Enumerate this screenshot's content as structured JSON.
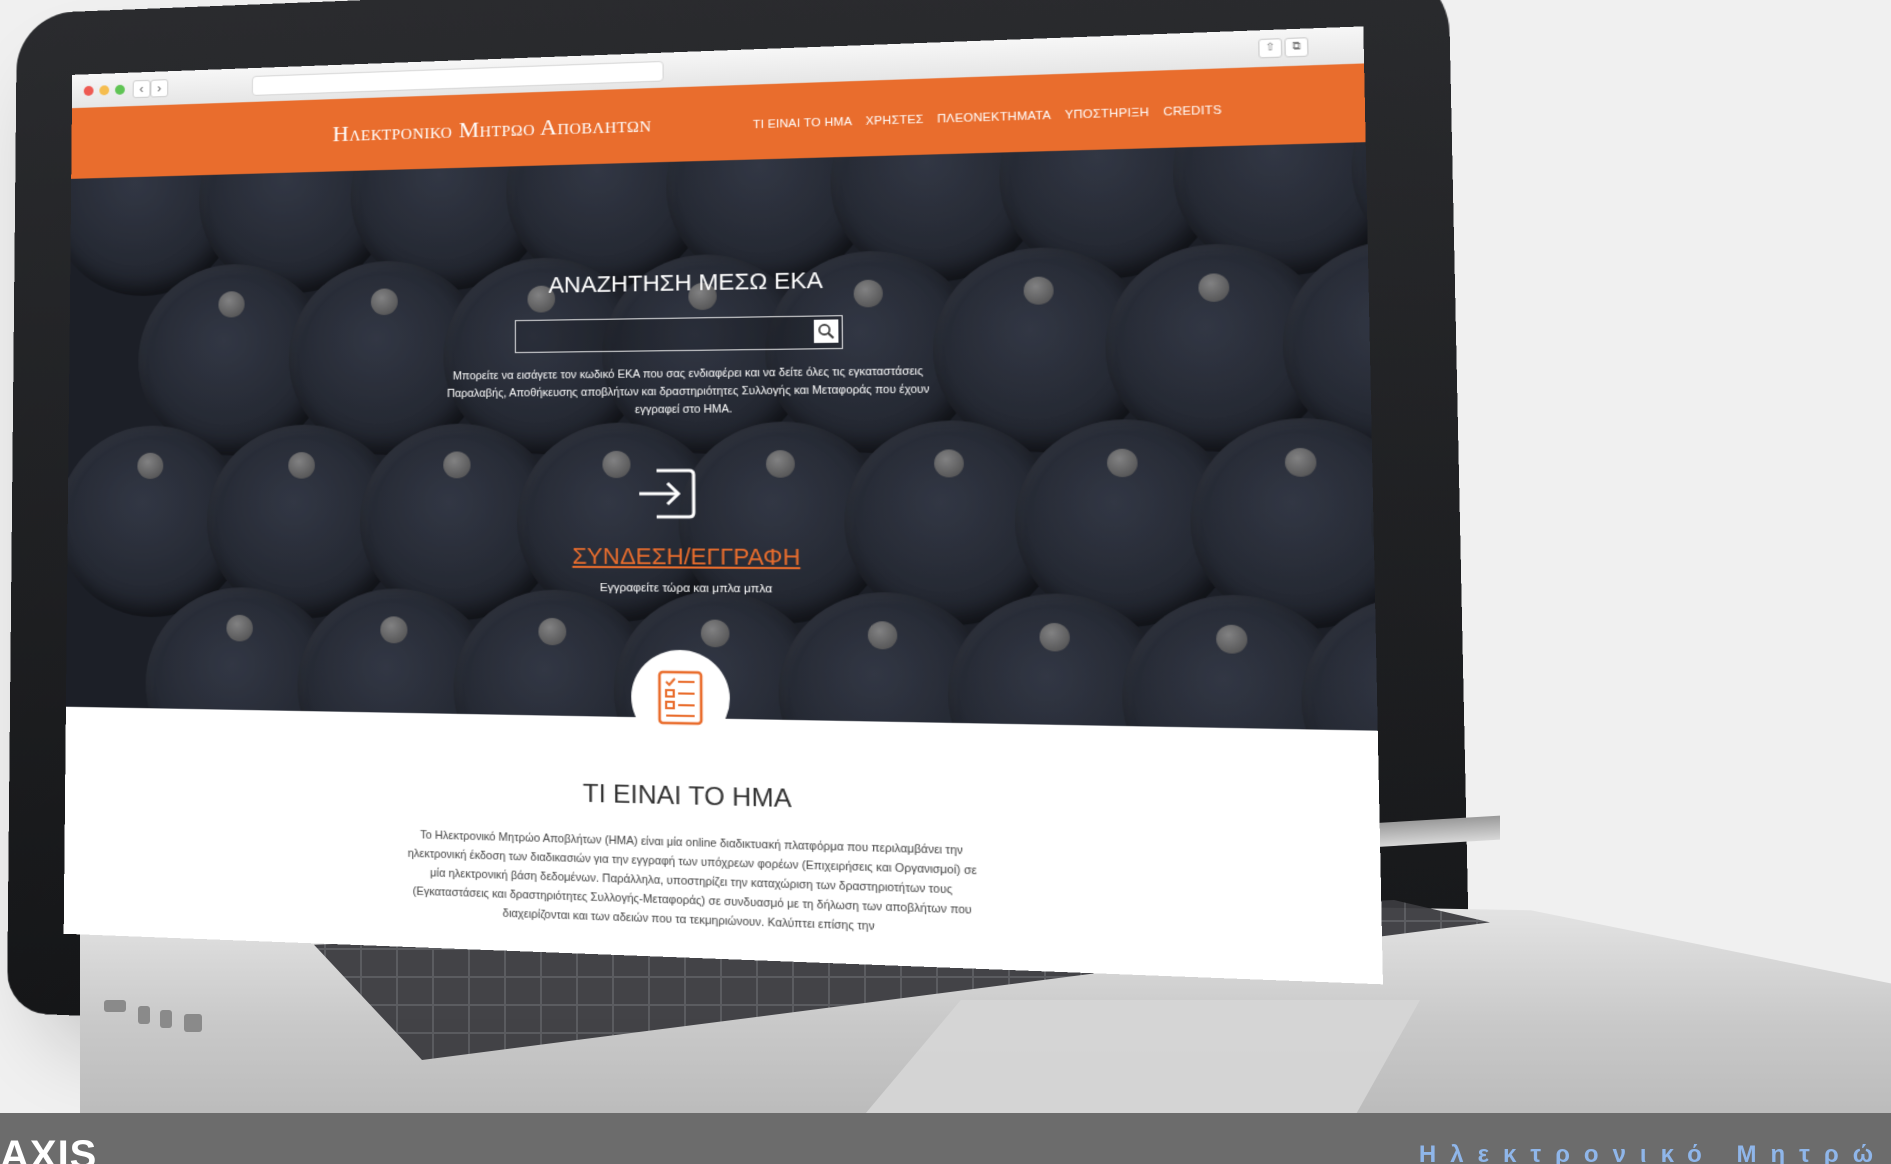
{
  "browser": {
    "back_icon": "chevron-left-icon",
    "forward_icon": "chevron-right-icon",
    "share_icon": "share-icon",
    "tabs_icon": "tabs-icon"
  },
  "site": {
    "brand": "Ηλεκτρονικο Μητρωο Αποβλητων",
    "accent_color": "#e96d2d",
    "nav": [
      "ΤΙ ΕΙΝΑΙ ΤΟ ΗΜΑ",
      "ΧΡΗΣΤΕΣ",
      "ΠΛΕΟΝΕΚΤΗΜΑΤΑ",
      "ΥΠΟΣΤΗΡΙΞΗ",
      "CREDITS"
    ]
  },
  "hero": {
    "search_title": "ΑΝΑΖΗΤΗΣΗ ΜΕΣΩ ΕΚΑ",
    "search_placeholder": "",
    "search_help": "Μπορείτε να εισάγετε τον κωδικό ΕΚΑ που σας ενδιαφέρει και να δείτε όλες τις εγκαταστάσεις Παραλαβής, Αποθήκευσης αποβλήτων και δραστηριότητες Συλλογής και Μεταφοράς που έχουν εγγραφεί στο ΗΜΑ.",
    "login_label": "ΣΥΝΔΕΣΗ/ΕΓΓΡΑΦΗ",
    "login_sub": "Εγγραφείτε τώρα και μπλα μπλα"
  },
  "about": {
    "title": "ΤΙ ΕΙΝΑΙ ΤΟ ΗΜΑ",
    "text": "Το Ηλεκτρονικό Μητρώο Αποβλήτων (ΗΜΑ) είναι μία online διαδικτυακή πλατφόρμα που περιλαμβάνει την ηλεκτρονική έκδοση των διαδικασιών για την εγγραφή των υπόχρεων φορέων (Επιχειρήσεις και Οργανισμοί) σε μία ηλεκτρονική βάση δεδομένων. Παράλληλα, υποστηρίζει την καταχώριση των δραστηριοτήτων τους (Εγκαταστάσεις και δραστηριότητες Συλλογής-Μεταφοράς) σε συνδυασμό με τη δήλωση των αποβλήτων που διαχειρίζονται και των αδειών που τα τεκμηριώνουν. Καλύπτει επίσης την"
  },
  "footer": {
    "logo": "AXIS",
    "tagline": "Ηλεκτρονικό Μητρώ"
  }
}
